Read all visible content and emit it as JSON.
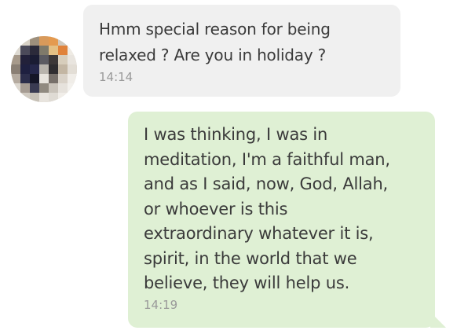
{
  "chat": {
    "messages": [
      {
        "direction": "incoming",
        "text": "Hmm special reason for being\nrelaxed ? Are you in holiday ?",
        "time": "14:14",
        "bubble_color": "#f0f0f0"
      },
      {
        "direction": "outgoing",
        "text": "I was thinking, I was in\nmeditation, I'm a faithful man,\nand as I said, now, God, Allah,\nor whoever is this\nextraordinary whatever it is,\nspirit, in the world that we\nbelieve, they will help us.",
        "time": "14:19",
        "bubble_color": "#dff0d4"
      }
    ]
  },
  "colors": {
    "text": "#3a3a3a",
    "timestamp": "#9a9a9a",
    "incoming_bubble": "#f0f0f0",
    "outgoing_bubble": "#dff0d4"
  },
  "icons": {
    "avatar": "pixelated-avatar"
  }
}
